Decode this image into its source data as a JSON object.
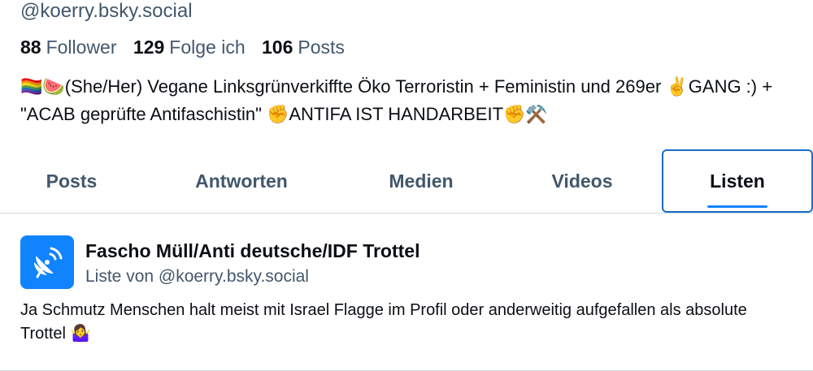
{
  "profile": {
    "handle": "@koerry.bsky.social",
    "followers_count": "88",
    "followers_label": "Follower",
    "following_count": "129",
    "following_label": "Folge ich",
    "posts_count": "106",
    "posts_label": "Posts",
    "bio": "🏳️‍🌈🍉(She/Her) Vegane Linksgrünverkiffte Öko Terroristin + Feministin und 269er ✌️GANG :) + \"ACAB geprüfte Antifaschistin\" ✊ANTIFA IST HANDARBEIT✊⚒️"
  },
  "tabs": [
    {
      "label": "Posts"
    },
    {
      "label": "Antworten"
    },
    {
      "label": "Medien"
    },
    {
      "label": "Videos"
    },
    {
      "label": "Listen",
      "active": true
    }
  ],
  "list": {
    "title": "Fascho Müll/Anti deutsche/IDF Trottel",
    "owner": "Liste von @koerry.bsky.social",
    "description": "Ja Schmutz Menschen halt meist mit Israel Flagge im Profil oder anderweitig aufgefallen als absolute Trottel 🤷‍♀️",
    "avatar_icon": "satellite-dish-icon",
    "avatar_color": "#1083fe"
  },
  "colors": {
    "text_primary": "#0b0f14",
    "text_secondary": "#42576c",
    "accent": "#1083fe",
    "divider": "#d4dbe2"
  }
}
